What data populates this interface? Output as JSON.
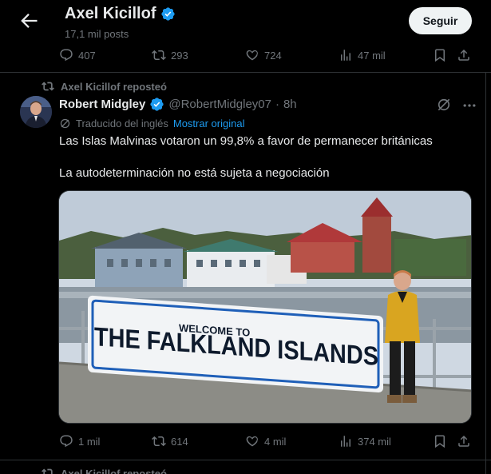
{
  "header": {
    "name": "Axel Kicillof",
    "posts": "17,1 mil posts",
    "follow_label": "Seguir"
  },
  "prev_post_actions": {
    "replies": "407",
    "reposts": "293",
    "likes": "724",
    "views": "47 mil"
  },
  "post": {
    "repost_by": "Axel Kicillof reposteó",
    "author_name": "Robert Midgley",
    "author_handle": "@RobertMidgley07",
    "dot": "·",
    "time": "8h",
    "translated_label": "Traducido del inglés",
    "show_original": "Mostrar original",
    "text_line_1": "Las Islas Malvinas votaron un 99,8% a favor de permanecer británicas",
    "text_line_2": "La autodeterminación no está sujeta a negociación",
    "media": {
      "sign_small": "WELCOME TO",
      "sign_large": "THE FALKLAND ISLANDS"
    },
    "actions": {
      "replies": "1 mil",
      "reposts": "614",
      "likes": "4 mil",
      "views": "374 mil"
    }
  },
  "next_post": {
    "repost_by": "Axel Kicillof reposteó"
  },
  "colors": {
    "background": "#000000",
    "text": "#e7e9ea",
    "muted": "#71767b",
    "accent": "#1d9bf0",
    "border": "#2f3336"
  },
  "icons": [
    "back-arrow-icon",
    "verified-icon",
    "reply-icon",
    "repost-icon",
    "like-icon",
    "views-icon",
    "bookmark-icon",
    "share-icon",
    "grok-icon",
    "more-icon",
    "translate-icon"
  ]
}
